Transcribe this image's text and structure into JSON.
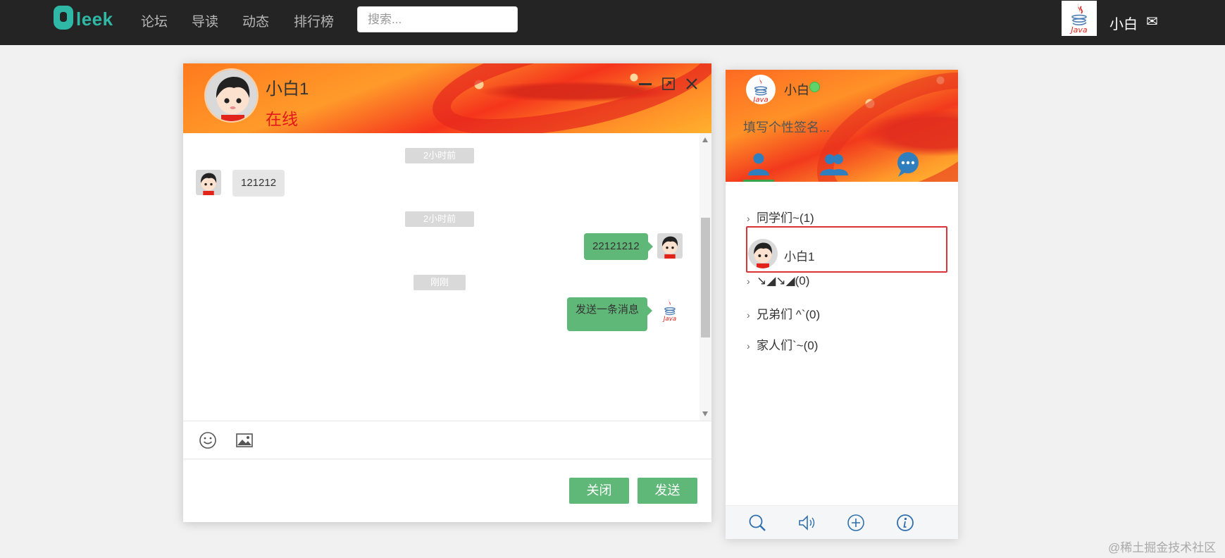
{
  "nav": {
    "logo_text": "leek",
    "links": [
      "论坛",
      "导读",
      "动态",
      "排行榜"
    ],
    "search_placeholder": "搜索...",
    "user_name": "小白",
    "mail_icon": "envelope-icon"
  },
  "chat": {
    "title": "小白1",
    "status": "在线",
    "status_color": "#e3161b",
    "messages": [
      {
        "type": "time",
        "text": "2小时前"
      },
      {
        "type": "incoming",
        "text": "121212"
      },
      {
        "type": "time",
        "text": "2小时前"
      },
      {
        "type": "outgoing",
        "text": "22121212"
      },
      {
        "type": "time",
        "text": "刚刚"
      },
      {
        "type": "outgoing",
        "text": "发送一条消息"
      }
    ],
    "tools": [
      "smile-icon",
      "image-icon"
    ],
    "close_label": "关闭",
    "send_label": "发送",
    "accent_color": "#5fb878"
  },
  "panel": {
    "name": "小白",
    "signature_placeholder": "填写个性签名...",
    "tabs": [
      "friends-tab-icon",
      "groups-tab-icon",
      "messages-tab-icon"
    ],
    "groups": [
      {
        "label": "同学们~(1)",
        "expanded": true,
        "friends": [
          {
            "name": "小白1"
          }
        ]
      },
      {
        "label": "↘◢↘◢(0)",
        "expanded": false
      },
      {
        "label": "兄弟们 ^`(0)",
        "expanded": false
      },
      {
        "label": "家人们`~(0)",
        "expanded": false
      }
    ],
    "footer_icons": [
      "search-icon",
      "sound-icon",
      "add-icon",
      "info-icon"
    ]
  },
  "watermark": "@稀土掘金技术社区"
}
